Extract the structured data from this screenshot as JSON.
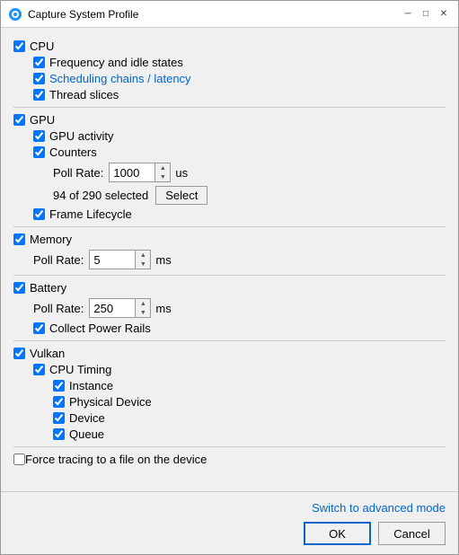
{
  "window": {
    "title": "Capture System Profile",
    "icon": "⚙"
  },
  "sections": {
    "cpu": {
      "label": "CPU",
      "checked": true,
      "children": [
        {
          "label": "Frequency and idle states",
          "checked": true,
          "blue": false
        },
        {
          "label": "Scheduling chains / latency",
          "checked": true,
          "blue": true
        },
        {
          "label": "Thread slices",
          "checked": true,
          "blue": false
        }
      ]
    },
    "gpu": {
      "label": "GPU",
      "checked": true,
      "gpu_activity": {
        "label": "GPU activity",
        "checked": true
      },
      "counters": {
        "label": "Counters",
        "checked": true,
        "poll_rate_label": "Poll Rate:",
        "poll_rate_value": "1000",
        "poll_rate_unit": "us",
        "selection_info": "94 of 290 selected",
        "select_btn_label": "Select"
      },
      "frame_lifecycle": {
        "label": "Frame Lifecycle",
        "checked": true
      }
    },
    "memory": {
      "label": "Memory",
      "checked": true,
      "poll_rate_label": "Poll Rate:",
      "poll_rate_value": "5",
      "poll_rate_unit": "ms"
    },
    "battery": {
      "label": "Battery",
      "checked": true,
      "poll_rate_label": "Poll Rate:",
      "poll_rate_value": "250",
      "poll_rate_unit": "ms",
      "collect_power_rails": {
        "label": "Collect Power Rails",
        "checked": true
      }
    },
    "vulkan": {
      "label": "Vulkan",
      "checked": true,
      "cpu_timing": {
        "label": "CPU Timing",
        "checked": true,
        "children": [
          {
            "label": "Instance",
            "checked": true
          },
          {
            "label": "Physical Device",
            "checked": true
          },
          {
            "label": "Device",
            "checked": true
          },
          {
            "label": "Queue",
            "checked": true
          }
        ]
      }
    }
  },
  "force_tracing": {
    "label": "Force tracing to a file on the device",
    "checked": false
  },
  "footer": {
    "switch_advanced": "Switch to advanced mode",
    "ok_label": "OK",
    "cancel_label": "Cancel"
  }
}
